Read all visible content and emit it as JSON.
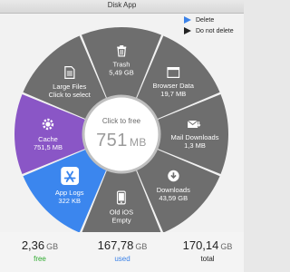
{
  "window": {
    "title": "Disk App"
  },
  "legend": [
    {
      "label": "Delete",
      "color": "#3b82e8"
    },
    {
      "label": "Do not delete",
      "color": "#222222"
    }
  ],
  "center": {
    "label": "Click to free",
    "value": "751",
    "unit": "MB"
  },
  "segments": [
    {
      "name": "Trash",
      "size": "5,49 GB",
      "icon": "trash-icon"
    },
    {
      "name": "Browser Data",
      "size": "19,7 MB",
      "icon": "browser-window-icon"
    },
    {
      "name": "Mail Downloads",
      "size": "1,3 MB",
      "icon": "mail-icon"
    },
    {
      "name": "Downloads",
      "size": "43,59 GB",
      "icon": "download-icon"
    },
    {
      "name": "Old iOS",
      "size": "Empty",
      "icon": "phone-icon"
    },
    {
      "name": "App Logs",
      "size": "322 KB",
      "icon": "app-store-icon"
    },
    {
      "name": "Cache",
      "size": "751,5 MB",
      "icon": "gear-icon"
    },
    {
      "name": "Large Files",
      "size": "Click to select",
      "icon": "document-icon"
    }
  ],
  "stats": [
    {
      "value": "2,36",
      "unit": "GB",
      "label": "free",
      "color": "#2eaa2e"
    },
    {
      "value": "167,78",
      "unit": "GB",
      "label": "used",
      "color": "#3b82e8"
    },
    {
      "value": "170,14",
      "unit": "GB",
      "label": "total",
      "color": "#222222"
    }
  ],
  "colors": {
    "ring_gray": "#6e6e6e",
    "cache_purple": "#8a56c6",
    "applogs_blue": "#3b86ee",
    "divider": "#ffffff"
  }
}
